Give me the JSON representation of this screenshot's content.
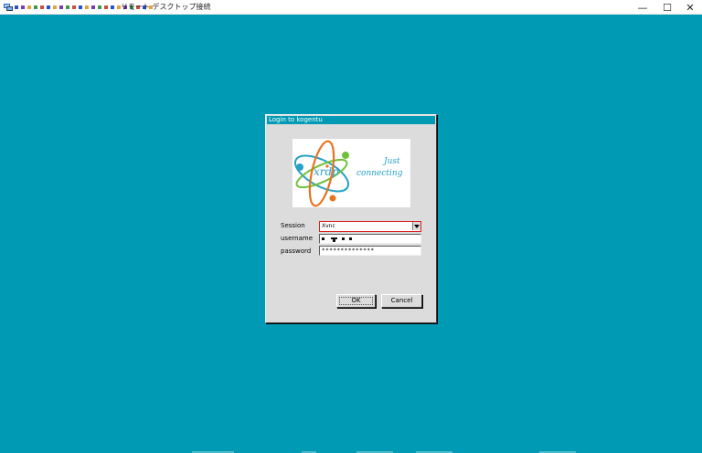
{
  "window": {
    "title": "リモート デスクトップ接続",
    "title_obscured_colors": [
      "#2a52be",
      "#7a3cb0",
      "#e8a23a",
      "#3a9a48",
      "#d14a3c",
      "#2a52be",
      "#e8a23a",
      "#7a3cb0",
      "#3a9a48",
      "#d14a3c",
      "#2a52be",
      "#e8a23a",
      "#7a3cb0",
      "#3a9a48",
      "#d14a3c",
      "#2a52be",
      "#e8a23a",
      "#7a3cb0",
      "#3a9a48",
      "#d14a3c",
      "#2a52be",
      "#e8a23a"
    ],
    "controls": {
      "minimize": "—",
      "maximize": "☐",
      "close": "✕"
    }
  },
  "desktop": {
    "background": "#009ab4"
  },
  "dialog": {
    "title": "Login to kogentu",
    "logo": {
      "word": "xrdp",
      "tagline_1": "Just",
      "tagline_2": "connecting"
    },
    "labels": {
      "session": "Session",
      "username": "username",
      "password": "password"
    },
    "session_value": "Xvnc",
    "password_value": "**************",
    "buttons": {
      "ok": "OK",
      "cancel": "Cancel"
    }
  }
}
